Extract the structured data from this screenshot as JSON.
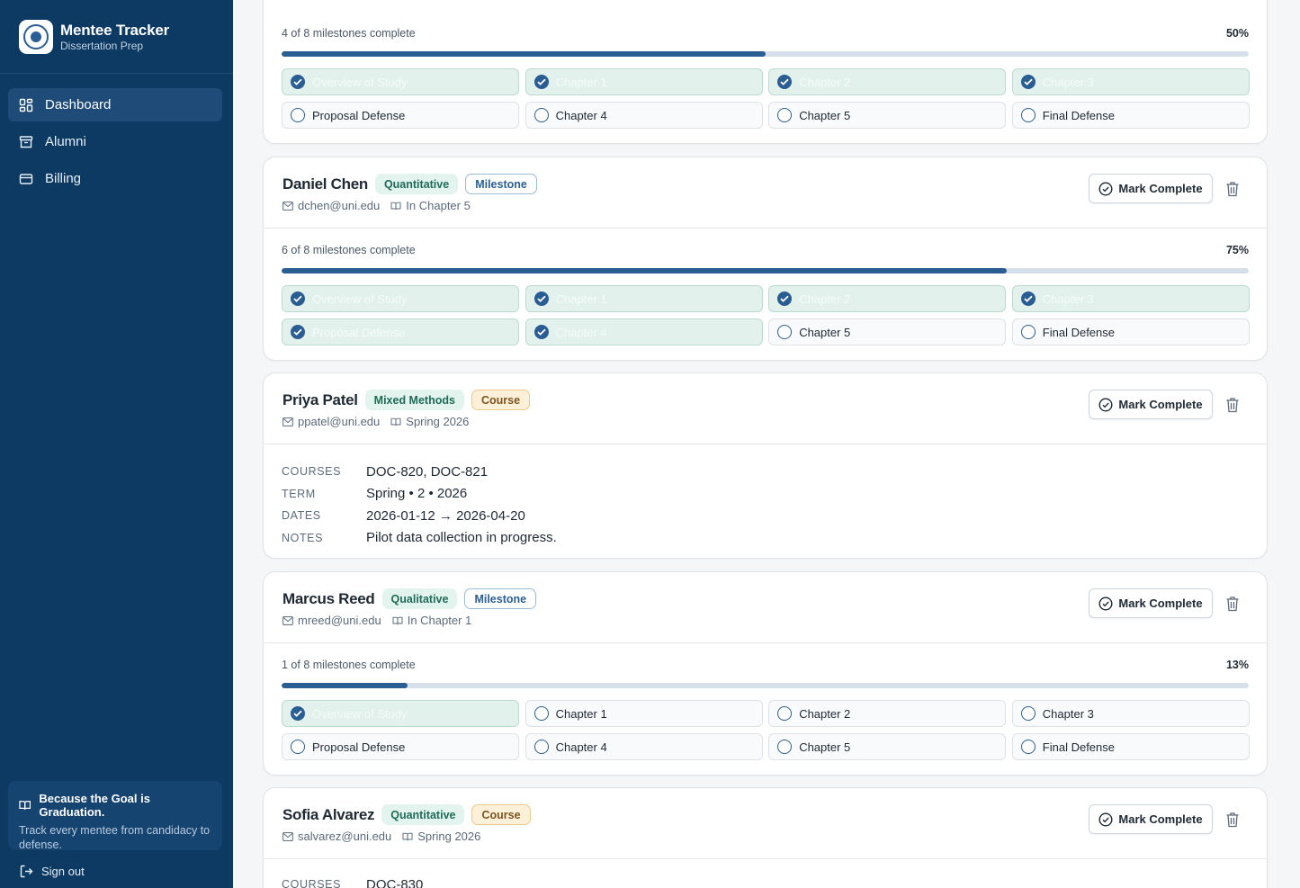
{
  "app": {
    "title": "Mentee Tracker",
    "subtitle": "Dissertation Prep"
  },
  "nav": [
    {
      "label": "Dashboard",
      "icon": "dashboard-icon",
      "active": true
    },
    {
      "label": "Alumni",
      "icon": "archive-icon",
      "active": false
    },
    {
      "label": "Billing",
      "icon": "credit-card-icon",
      "active": false
    }
  ],
  "promo": {
    "title": "Because the Goal is Graduation.",
    "text": "Track every mentee from candidacy to defense."
  },
  "signout": "Sign out",
  "actions": {
    "mark_complete": "Mark Complete"
  },
  "colors": {
    "sidebar": "#0d3a63",
    "accent": "#2a5d92",
    "done_bg": "#e3f1ec"
  },
  "mentees": [
    {
      "progress_label": "4 of 8 milestones complete",
      "progress_pct": "50%",
      "progress_value": 0.5,
      "milestones": [
        {
          "label": "Overview of Study",
          "done": true
        },
        {
          "label": "Chapter 1",
          "done": true
        },
        {
          "label": "Chapter 2",
          "done": true
        },
        {
          "label": "Chapter 3",
          "done": true
        },
        {
          "label": "Proposal Defense",
          "done": false
        },
        {
          "label": "Chapter 4",
          "done": false
        },
        {
          "label": "Chapter 5",
          "done": false
        },
        {
          "label": "Final Defense",
          "done": false
        }
      ]
    },
    {
      "name": "Daniel Chen",
      "method": "Quantitative",
      "type": "Milestone",
      "email": "dchen@uni.edu",
      "status": "In Chapter 5",
      "progress_label": "6 of 8 milestones complete",
      "progress_pct": "75%",
      "progress_value": 0.75,
      "milestones": [
        {
          "label": "Overview of Study",
          "done": true
        },
        {
          "label": "Chapter 1",
          "done": true
        },
        {
          "label": "Chapter 2",
          "done": true
        },
        {
          "label": "Chapter 3",
          "done": true
        },
        {
          "label": "Proposal Defense",
          "done": true
        },
        {
          "label": "Chapter 4",
          "done": true
        },
        {
          "label": "Chapter 5",
          "done": false
        },
        {
          "label": "Final Defense",
          "done": false
        }
      ]
    },
    {
      "name": "Priya Patel",
      "method": "Mixed Methods",
      "type": "Course",
      "email": "ppatel@uni.edu",
      "status": "Spring 2026",
      "course": [
        {
          "key": "COURSES",
          "value": "DOC-820, DOC-821"
        },
        {
          "key": "TERM",
          "value": "Spring • 2 • 2026"
        },
        {
          "key": "DATES",
          "value": "2026-01-12 → 2026-04-20"
        },
        {
          "key": "NOTES",
          "value": "Pilot data collection in progress."
        }
      ]
    },
    {
      "name": "Marcus Reed",
      "method": "Qualitative",
      "type": "Milestone",
      "email": "mreed@uni.edu",
      "status": "In Chapter 1",
      "progress_label": "1 of 8 milestones complete",
      "progress_pct": "13%",
      "progress_value": 0.13,
      "milestones": [
        {
          "label": "Overview of Study",
          "done": true
        },
        {
          "label": "Chapter 1",
          "done": false
        },
        {
          "label": "Chapter 2",
          "done": false
        },
        {
          "label": "Chapter 3",
          "done": false
        },
        {
          "label": "Proposal Defense",
          "done": false
        },
        {
          "label": "Chapter 4",
          "done": false
        },
        {
          "label": "Chapter 5",
          "done": false
        },
        {
          "label": "Final Defense",
          "done": false
        }
      ]
    },
    {
      "name": "Sofia Alvarez",
      "method": "Quantitative",
      "type": "Course",
      "email": "salvarez@uni.edu",
      "status": "Spring 2026",
      "course": [
        {
          "key": "COURSES",
          "value": "DOC-830"
        }
      ]
    }
  ]
}
